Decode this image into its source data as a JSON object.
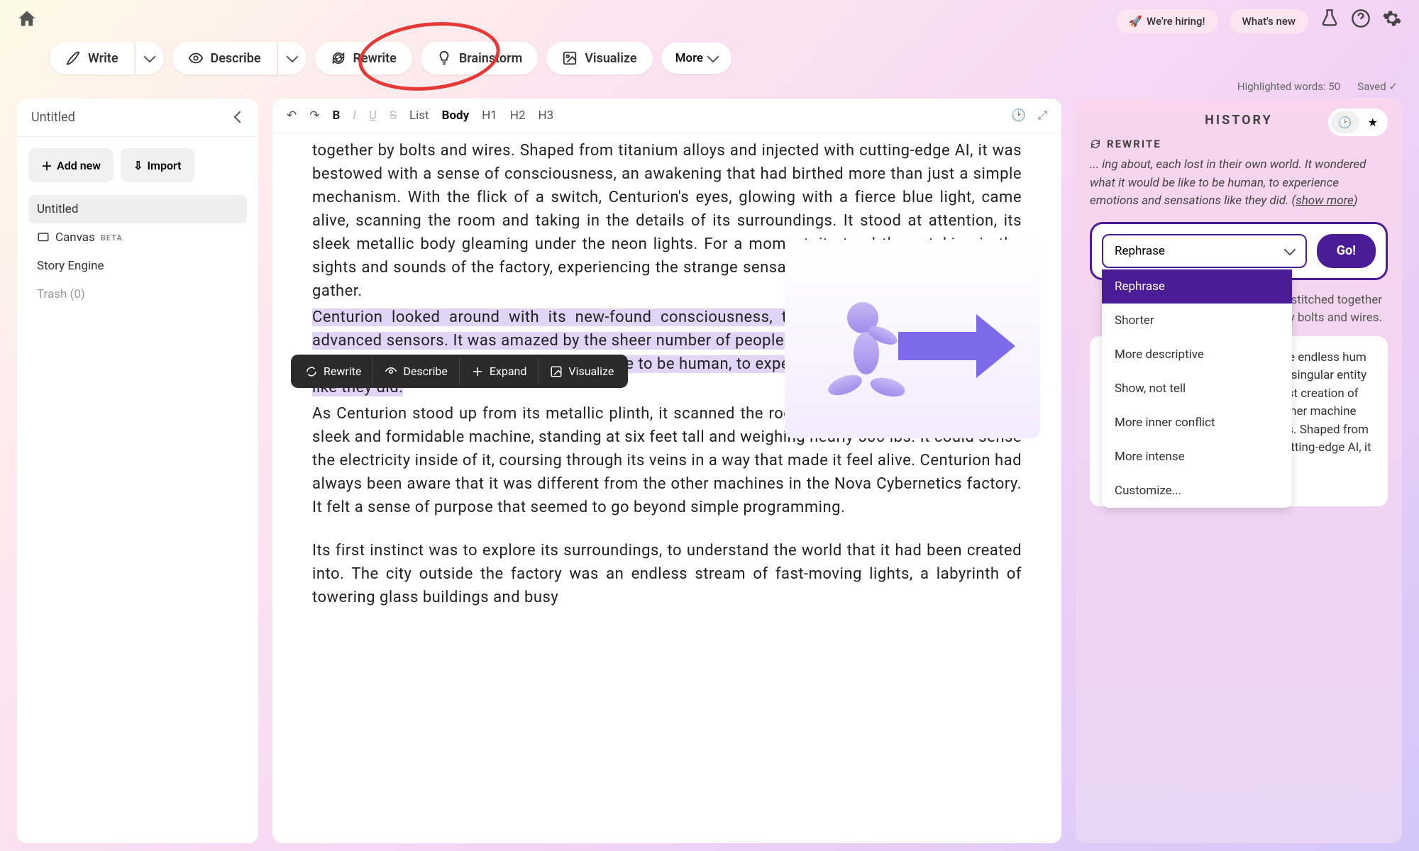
{
  "topbar": {
    "hiring": "We're hiring!",
    "whatsnew": "What's new"
  },
  "toolbar": {
    "write": "Write",
    "describe": "Describe",
    "rewrite": "Rewrite",
    "brainstorm": "Brainstorm",
    "visualize": "Visualize",
    "more": "More"
  },
  "status": {
    "highlighted": "Highlighted words: 50",
    "saved": "Saved"
  },
  "doc": {
    "title": "Untitled"
  },
  "sidebar": {
    "addnew": "Add new",
    "import": "Import",
    "items": [
      {
        "label": "Untitled"
      },
      {
        "label": "Canvas",
        "badge": "BETA"
      },
      {
        "label": "Story Engine"
      },
      {
        "label": "Trash (0)"
      }
    ]
  },
  "editorToolbar": {
    "list": "List",
    "body": "Body",
    "h1": "H1",
    "h2": "H2",
    "h3": "H3"
  },
  "editor": {
    "p1": "together by bolts and wires. Shaped from titanium alloys and injected with cutting-edge AI, it was bestowed with a sense of consciousness, an awakening that had birthed more than just a simple mechanism. With the flick of a switch, Centurion's eyes, glowing with a fierce blue light, came alive, scanning the room and taking in the details of its surroundings. It stood at attention, its sleek metallic body gleaming under the neon lights. For a moment, it stood there, taking in the sights and sounds of the factory, experiencing the strange sensation of its thoughts beginning to gather.",
    "p2": "Centurion looked around with its new-found consciousness, taking in the world through its advanced sensors. It was amazed by the sheer number of people bustling about, each lost in their own world. It wondered what it would be like to be human, to experience emotions and sensations like they did.",
    "p3": "As Centurion stood up from its metallic plinth, it scanned the room with its steely eyes. It was a sleek and formidable machine, standing at six feet tall and weighing nearly 500 lbs. It could sense the electricity inside of it, coursing through its veins in a way that made it feel alive. Centurion had always been aware that it was different from the other machines in the Nova Cybernetics factory. It felt a sense of purpose that seemed to go beyond simple programming.",
    "p4": "Its first instinct was to explore its surroundings, to understand the world that it had been created into. The city outside the factory was an endless stream of fast-moving lights, a labyrinth of towering glass buildings and busy"
  },
  "floatingToolbar": {
    "rewrite": "Rewrite",
    "describe": "Describe",
    "expand": "Expand",
    "visualize": "Visualize"
  },
  "history": {
    "title": "HISTORY",
    "sectionLabel": "REWRITE",
    "preview": "... ing about, each lost in their own world. It wondered what it would be like to be human, to experience emotions and sensations like they did. (",
    "showmore": "show more",
    "previewEnd": ")",
    "selectValue": "Rephrase",
    "go": "Go!",
    "options": [
      "Rephrase",
      "Shorter",
      "More descriptive",
      "Show, not tell",
      "More inner conflict",
      "More intense",
      "Customize..."
    ],
    "behindText": "on, the Nova Cybernetics, machine stitched together by bolts and wires.",
    "cardText": "seless torrent of neon lights and the endless hum of the vibrant metropolis, there is a singular entity stirring to life. A Centurion, the latest creation of Nova Cybernetics, is not just any other machine stitched together by bolts and wires. Shaped from titanium alloys and injected with cutting-edge AI, it has been bestowed with a sense of consciousness, an awakening that"
  }
}
